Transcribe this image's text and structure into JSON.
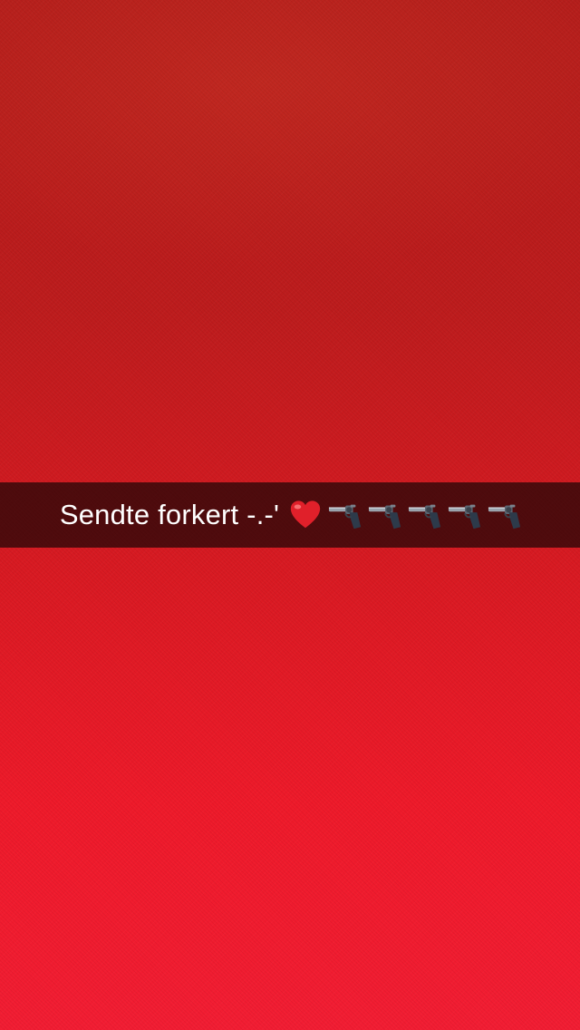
{
  "snap": {
    "caption": "Sendte forkert -.-'",
    "emojis": [
      {
        "icon": "red-heart-emoji",
        "glyph": "❤️"
      },
      {
        "icon": "pistol-emoji",
        "glyph": "🔫"
      },
      {
        "icon": "pistol-emoji",
        "glyph": "🔫"
      },
      {
        "icon": "pistol-emoji",
        "glyph": "🔫"
      },
      {
        "icon": "pistol-emoji",
        "glyph": "🔫"
      },
      {
        "icon": "pistol-emoji",
        "glyph": "🔫"
      }
    ]
  },
  "colors": {
    "photo_top": "#b41d1b",
    "photo_bottom": "#f21d33",
    "caption_bar": "#1c0606",
    "caption_text": "#ffffff"
  }
}
